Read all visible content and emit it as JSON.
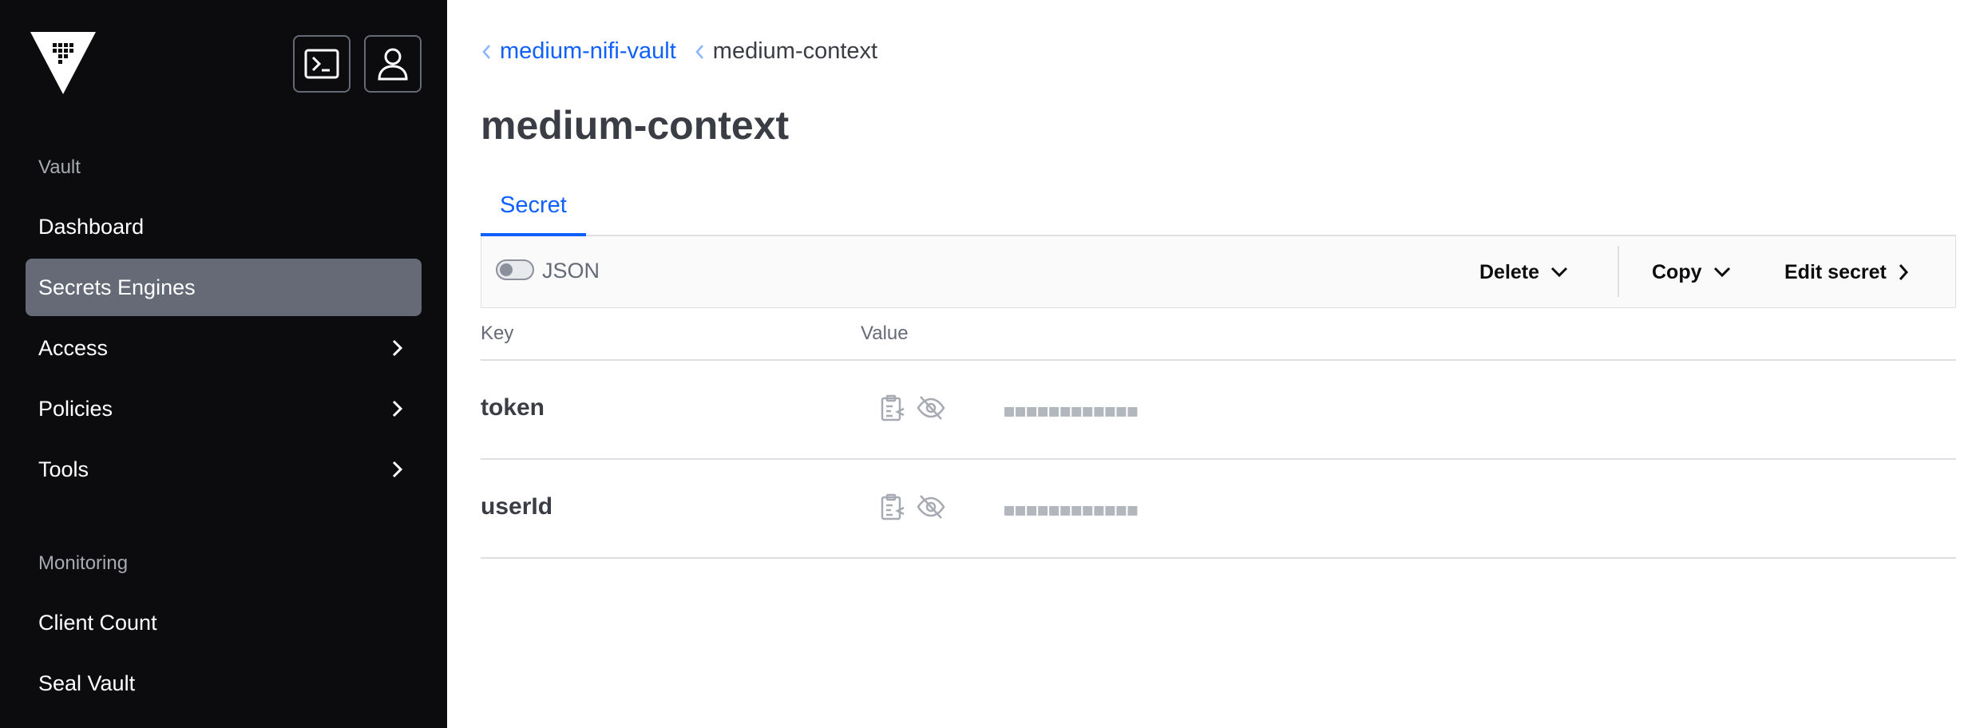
{
  "sidebar": {
    "brand_icon": "vault-logo-icon",
    "top_buttons": {
      "console_icon": "terminal-icon",
      "user_icon": "user-icon"
    },
    "sections": [
      {
        "label": "Vault",
        "items": [
          {
            "label": "Dashboard",
            "has_chevron": false,
            "active": false
          },
          {
            "label": "Secrets Engines",
            "has_chevron": false,
            "active": true
          },
          {
            "label": "Access",
            "has_chevron": true,
            "active": false
          },
          {
            "label": "Policies",
            "has_chevron": true,
            "active": false
          },
          {
            "label": "Tools",
            "has_chevron": true,
            "active": false
          }
        ]
      },
      {
        "label": "Monitoring",
        "items": [
          {
            "label": "Client Count",
            "has_chevron": false,
            "active": false
          },
          {
            "label": "Seal Vault",
            "has_chevron": false,
            "active": false
          }
        ]
      }
    ]
  },
  "breadcrumb": {
    "parent": "medium-nifi-vault",
    "current": "medium-context"
  },
  "page_title": "medium-context",
  "tabs": [
    {
      "label": "Secret",
      "active": true
    }
  ],
  "toolbar": {
    "json_toggle_label": "JSON",
    "json_toggle_on": false,
    "delete_label": "Delete",
    "copy_label": "Copy",
    "edit_label": "Edit secret"
  },
  "table": {
    "headers": {
      "key": "Key",
      "value": "Value"
    },
    "rows": [
      {
        "key": "token",
        "masked_value": "■■■■■■■■■■■■"
      },
      {
        "key": "userId",
        "masked_value": "■■■■■■■■■■■■"
      }
    ]
  },
  "colors": {
    "sidebar_bg": "#0c0c0e",
    "active_nav_bg": "#656a76",
    "accent": "#1060ff"
  }
}
